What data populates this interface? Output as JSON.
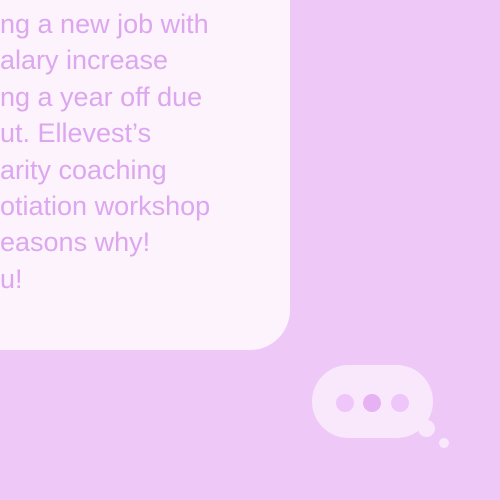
{
  "message": {
    "lines": [
      "ng a new job with",
      "alary increase",
      "ng a year off due",
      "ut. Ellevest’s",
      "arity coaching",
      "otiation workshop",
      "easons why!",
      "u!"
    ]
  },
  "typing_indicator": {
    "icon": "typing-dots-icon"
  },
  "colors": {
    "background": "#eec9f8",
    "card": "#fcf3fd",
    "text": "#dca7ee"
  }
}
